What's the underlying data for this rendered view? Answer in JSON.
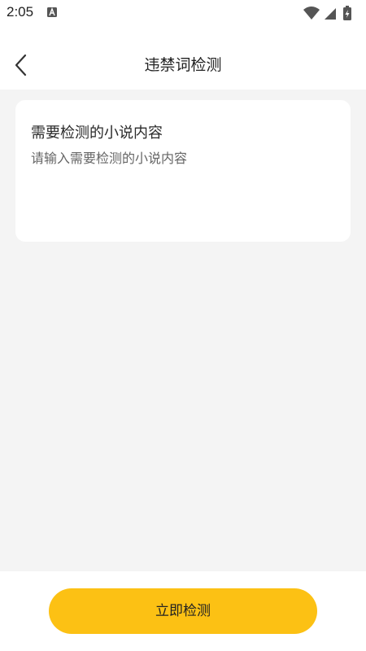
{
  "status_bar": {
    "time": "2:05",
    "icons": [
      "a-notification-icon",
      "wifi-icon",
      "cell-signal-icon",
      "battery-charging-icon"
    ]
  },
  "header": {
    "title": "违禁词检测",
    "back_icon": "chevron-left-icon"
  },
  "card": {
    "title": "需要检测的小说内容",
    "input_value": "",
    "input_placeholder": "请输入需要检测的小说内容"
  },
  "footer": {
    "submit_label": "立即检测"
  },
  "colors": {
    "accent": "#fcc114",
    "background": "#f4f4f4",
    "card": "#ffffff"
  }
}
